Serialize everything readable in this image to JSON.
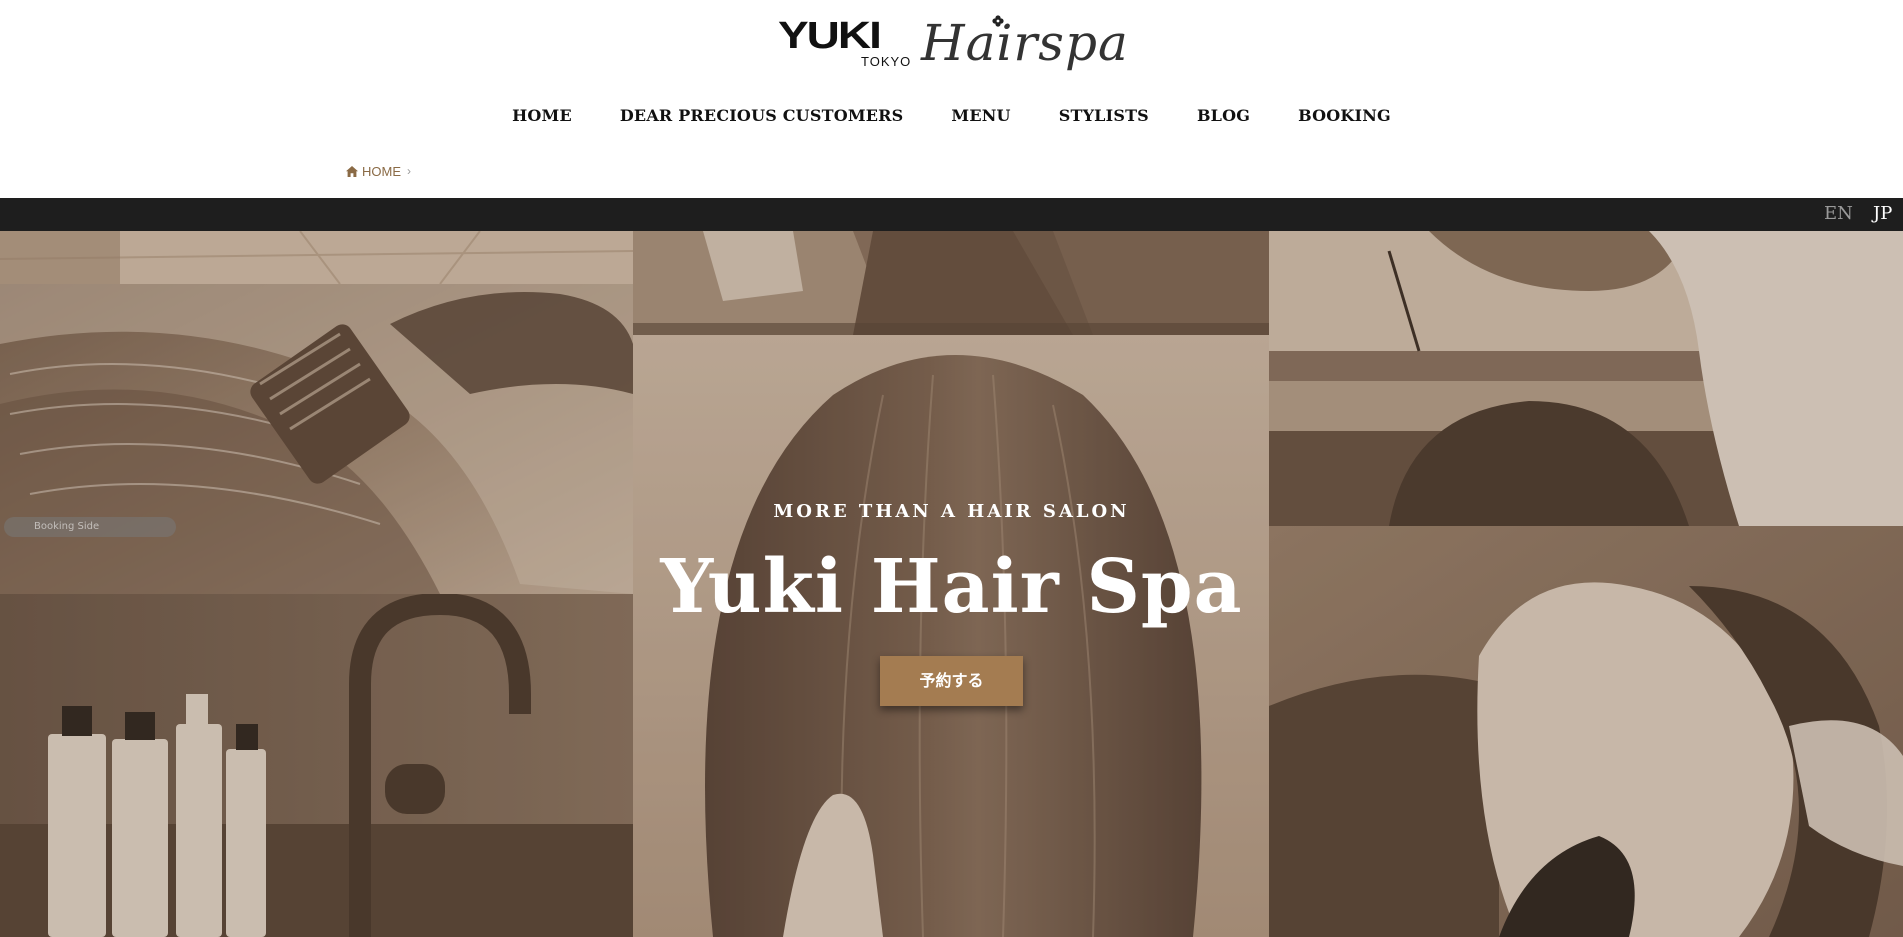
{
  "logo": {
    "brand": "YUKI",
    "city": "TOKYO",
    "script": "Hairspa"
  },
  "nav": {
    "items": [
      {
        "label": "HOME"
      },
      {
        "label": "DEAR PRECIOUS CUSTOMERS"
      },
      {
        "label": "MENU"
      },
      {
        "label": "STYLISTS"
      },
      {
        "label": "BLOG"
      },
      {
        "label": "BOOKING"
      }
    ]
  },
  "breadcrumb": {
    "home_label": "HOME",
    "separator": "›",
    "icon": "home-icon"
  },
  "language": {
    "en_label": "EN",
    "jp_label": "JP",
    "active": "JP"
  },
  "hero": {
    "eyebrow": "MORE THAN A HAIR SALON",
    "title": "Yuki Hair Spa",
    "button_label": "予約する",
    "side_handle_label": "Booking Side",
    "tiles": [
      {
        "name": "hair-color-brush-photo"
      },
      {
        "name": "salon-ceiling-photo"
      },
      {
        "name": "bathroom-tiles-photo"
      },
      {
        "name": "long-straight-hair-photo"
      },
      {
        "name": "stylist-cutting-hair-photo"
      },
      {
        "name": "shampoo-bottles-faucet-photo"
      },
      {
        "name": "head-spa-massage-photo"
      }
    ]
  },
  "colors": {
    "accent": "#a47c51",
    "breadcrumb": "#8a6a45",
    "langbar": "#1e1e1e",
    "sepia_dark": "#6f5a49",
    "sepia_light": "#d9c7b3"
  }
}
